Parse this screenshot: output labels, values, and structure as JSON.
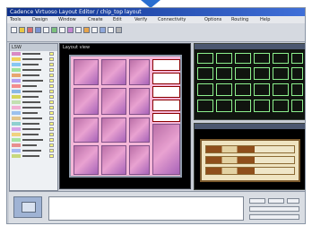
{
  "window": {
    "title": "Cadence Virtuoso Layout Editor  /  chip_top  layout",
    "menu": [
      "Tools",
      "Design",
      "Window",
      "Create",
      "Edit",
      "Verify",
      "Connectivity",
      "Options",
      "Routing",
      "Help"
    ]
  },
  "panels": {
    "layers": {
      "header": "LSW"
    },
    "main": {
      "caption": "Layout view"
    },
    "detail": {
      "caption": ""
    },
    "row": {
      "caption": ""
    },
    "console": {
      "text": ""
    }
  },
  "colors": {
    "accent": "#2a6fd0",
    "title": "#0d2f8a",
    "die": "#f4b7d8",
    "cells": "#8df08d",
    "panel": "#efe4c1"
  }
}
